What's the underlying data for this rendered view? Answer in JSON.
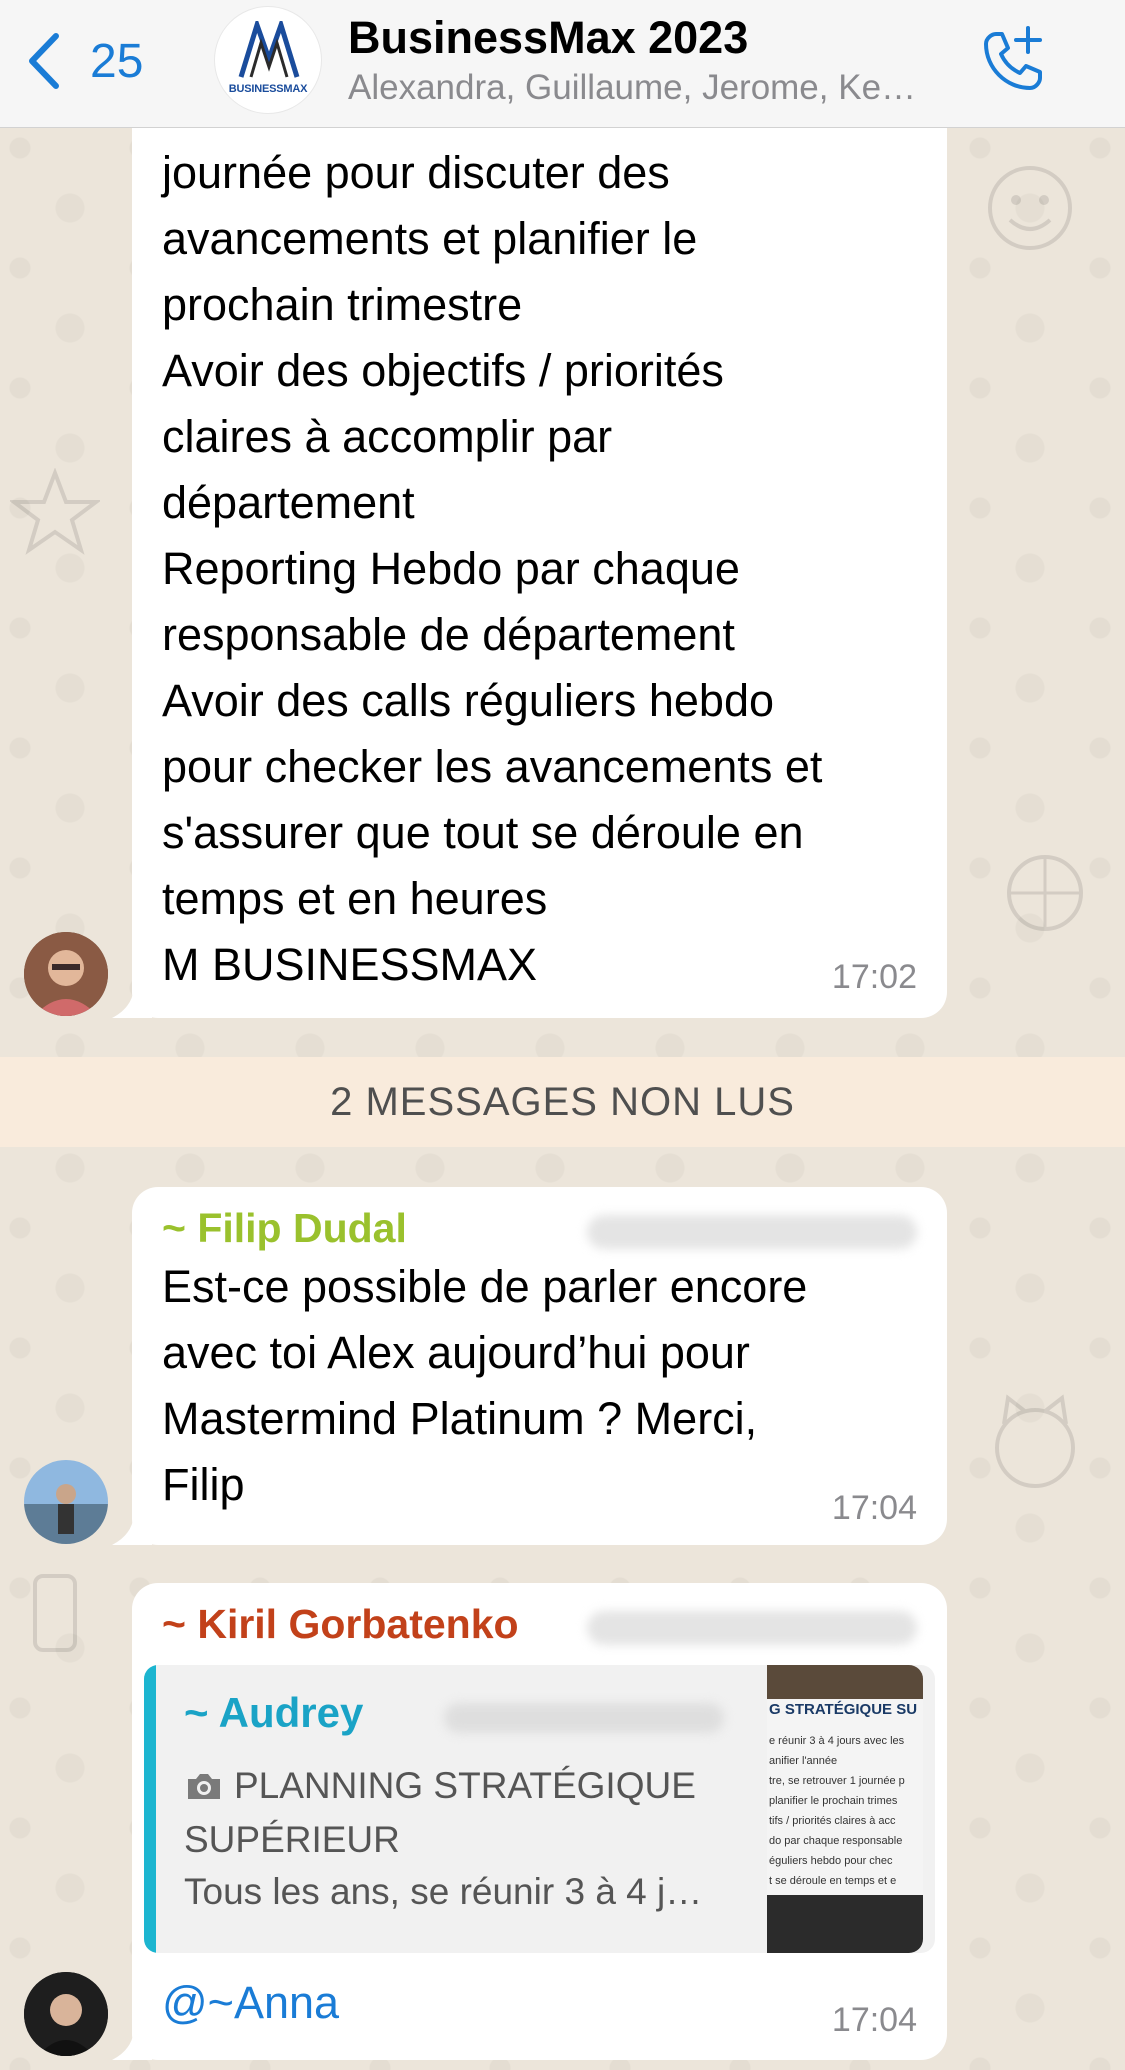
{
  "header": {
    "back_count": "25",
    "group_title": "BusinessMax 2023",
    "members": "Alexandra, Guillaume, Jerome, Ke…",
    "avatar_logo_text": "BUSINESSMAX"
  },
  "messages": [
    {
      "lines": [
        "journée pour discuter des",
        "avancements et planifier le",
        "prochain trimestre",
        "Avoir des objectifs / priorités",
        "claires à accomplir par",
        "département",
        "Reporting Hebdo par chaque",
        "responsable de département",
        "Avoir des calls réguliers hebdo",
        "pour checker les avancements et",
        "s'assurer que tout se déroule en",
        "temps et en heures",
        "M BUSINESSMAX"
      ],
      "time": "17:02"
    },
    {
      "sender": "~ Filip Dudal",
      "sender_color": "#9ac12d",
      "lines": [
        "Est-ce possible de parler encore",
        "avec toi Alex aujourd’hui pour",
        "Mastermind Platinum ? Merci,",
        "Filip"
      ],
      "time": "17:04"
    },
    {
      "sender": "~ Kiril Gorbatenko",
      "sender_color": "#c2411a",
      "quote": {
        "sender": "~ Audrey",
        "title_line1": "PLANNING STRATÉGIQUE",
        "title_line2": "SUPÉRIEUR",
        "snippet": "Tous les ans, se réunir 3 à 4 j…",
        "thumb_heading": "G STRATÉGIQUE SU",
        "thumb_lines": [
          "e réunir 3 à 4 jours avec les",
          "anifier l'année",
          "tre, se retrouver 1 journée p",
          " planifier le prochain trimes",
          "tifs / priorités claires à acc",
          "do par chaque responsable",
          "éguliers hebdo pour chec",
          "t se déroule en temps et e"
        ]
      },
      "mention": "@~Anna",
      "time": "17:04"
    }
  ],
  "unread_banner": "2 MESSAGES NON LUS",
  "colors": {
    "accent": "#1a7cd6",
    "quote_bar": "#1cb5d0",
    "unread_bg": "#f9ebdc"
  }
}
